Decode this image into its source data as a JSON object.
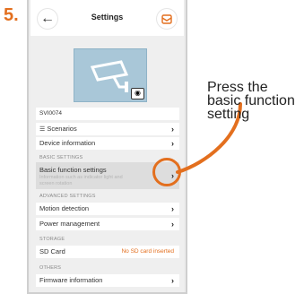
{
  "step_number": "5.",
  "header": {
    "title": "Settings"
  },
  "device": {
    "name": "SVI0074"
  },
  "rows": {
    "scenarios": "Scenarios",
    "device_information": "Device information"
  },
  "sections": {
    "basic": "BASIC SETTINGS",
    "advanced": "ADVANCED SETTINGS",
    "storage": "STORAGE",
    "others": "OTHERS"
  },
  "basic_function": {
    "label": "Basic function settings",
    "description": "Information such as indicator light and screen rotation"
  },
  "advanced": {
    "motion": "Motion detection",
    "power": "Power management"
  },
  "storage": {
    "label": "SD Card",
    "value": "No SD card inserted"
  },
  "others": {
    "firmware": "Firmware information"
  },
  "annotation": {
    "line1": "Press the",
    "line2": "basic function",
    "line3": "setting"
  },
  "colors": {
    "accent": "#e36f1e",
    "camera_bg": "#a9c7d8"
  }
}
